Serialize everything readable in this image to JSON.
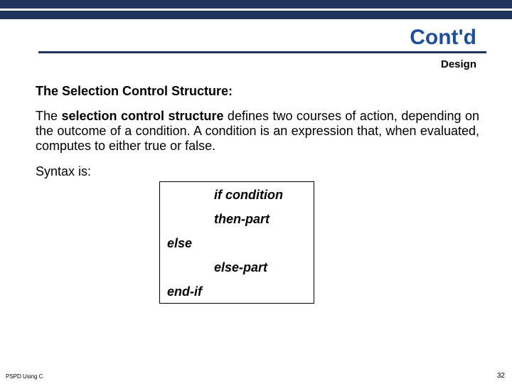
{
  "header": {
    "title": "Cont'd",
    "subtitle": "Design"
  },
  "content": {
    "heading": "The Selection Control Structure:",
    "para_before_bold": "The ",
    "para_bold": "selection  control structure",
    "para_after_bold": " defines two courses of action, depending on the outcome of a condition.  A condition is an expression that, when evaluated, computes to either true or false.",
    "syntax_label": "Syntax is:"
  },
  "code": {
    "l1": "if condition",
    "l2": "then-part",
    "l3": "else",
    "l4": "else-part",
    "l5": "end-if"
  },
  "footer": {
    "left": "PSPD Using C",
    "page": "32"
  }
}
